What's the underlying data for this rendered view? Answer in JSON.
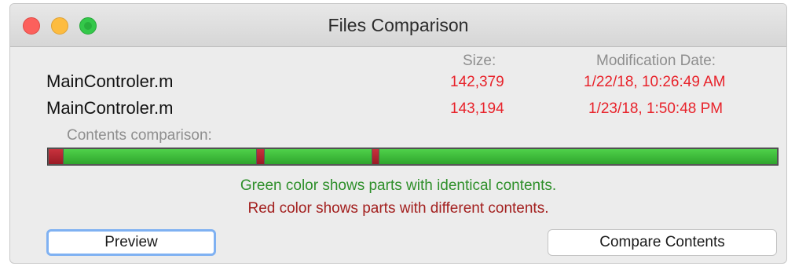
{
  "window": {
    "title": "Files Comparison"
  },
  "headers": {
    "size": "Size:",
    "modification_date": "Modification Date:"
  },
  "files": [
    {
      "name": "MainControler.m",
      "size": "142,379",
      "date": "1/22/18, 10:26:49 AM"
    },
    {
      "name": "MainControler.m",
      "size": "143,194",
      "date": "1/23/18, 1:50:48 PM"
    }
  ],
  "comparison": {
    "label": "Contents comparison:",
    "segments": [
      {
        "type": "different",
        "fraction": 0.02
      },
      {
        "type": "identical",
        "fraction": 0.265
      },
      {
        "type": "different",
        "fraction": 0.01
      },
      {
        "type": "identical",
        "fraction": 0.148
      },
      {
        "type": "different",
        "fraction": 0.008
      },
      {
        "type": "identical",
        "fraction": 0.549
      }
    ],
    "legend_green": "Green color shows parts with identical contents.",
    "legend_red": "Red color shows parts with different contents.",
    "colors": {
      "identical": "#3bbd38",
      "different": "#b0232e"
    }
  },
  "buttons": {
    "preview": "Preview",
    "compare": "Compare Contents"
  }
}
